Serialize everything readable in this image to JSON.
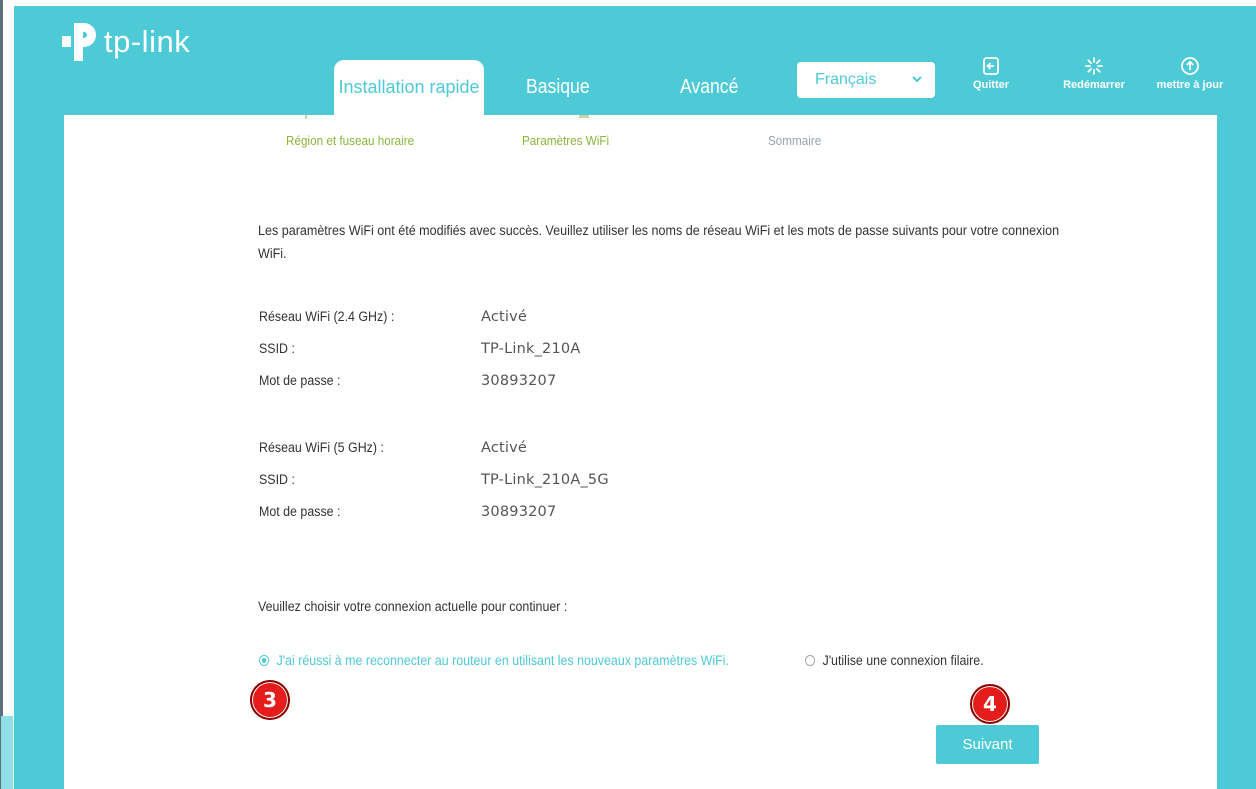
{
  "brand": {
    "name": "tp-link"
  },
  "nav": {
    "tabs": [
      {
        "label": "Installation rapide",
        "active": true
      },
      {
        "label": "Basique",
        "active": false
      },
      {
        "label": "Avancé",
        "active": false
      }
    ],
    "language": {
      "selected": "Français"
    },
    "actions": [
      {
        "label": "Quitter",
        "icon": "exit-icon"
      },
      {
        "label": "Redémarrer",
        "icon": "restart-icon"
      },
      {
        "label": "mettre à jour",
        "icon": "upload-icon"
      }
    ]
  },
  "steps": [
    {
      "label": "Région et fuseau horaire",
      "state": "done"
    },
    {
      "label": "Paramètres WiFi",
      "state": "done"
    },
    {
      "label": "Sommaire",
      "state": "pending"
    }
  ],
  "intro": "Les paramètres WiFi ont été modifiés avec succès. Veuillez utiliser les noms de réseau WiFi et les mots de passe suivants pour votre connexion WiFi.",
  "wifi_24": {
    "network_label": "Réseau WiFi (2.4 GHz) :",
    "network_value": "Activé",
    "ssid_label": "SSID :",
    "ssid_value": "TP-Link_210A",
    "password_label": "Mot de passe :",
    "password_value": "30893207"
  },
  "wifi_5": {
    "network_label": "Réseau WiFi (5 GHz) :",
    "network_value": "Activé",
    "ssid_label": "SSID :",
    "ssid_value": "TP-Link_210A_5G",
    "password_label": "Mot de passe :",
    "password_value": "30893207"
  },
  "connection": {
    "prompt": "Veuillez choisir votre connexion actuelle pour continuer :",
    "options": [
      {
        "label": "J'ai réussi à me reconnecter au routeur en utilisant les nouveaux paramètres WiFi.",
        "selected": true
      },
      {
        "label": "J'utilise une connexion filaire.",
        "selected": false
      }
    ]
  },
  "next_button": "Suivant",
  "markers": [
    "3",
    "4"
  ],
  "colors": {
    "accent": "#4ec9d6",
    "step_done": "#8ab53c",
    "marker": "#e41c1c"
  }
}
